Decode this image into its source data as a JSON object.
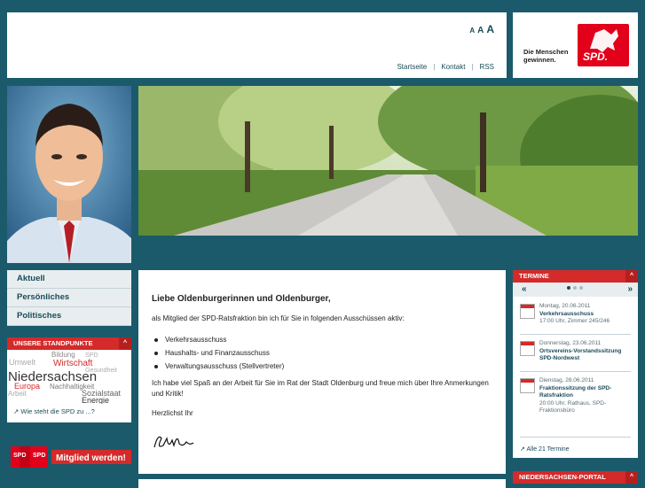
{
  "header": {
    "font_sizes": [
      "A",
      "A",
      "A"
    ],
    "nav": [
      "Startseite",
      "Kontakt",
      "RSS"
    ]
  },
  "logo": {
    "slogan_line1": "Die Menschen",
    "slogan_line2": "gewinnen.",
    "mark_text": "SPD."
  },
  "left_nav": {
    "items": [
      "Aktuell",
      "Persönliches",
      "Politisches"
    ]
  },
  "standpunkte": {
    "heading": "UNSERE STANDPUNKTE",
    "toggle": "^",
    "cloud_words": [
      "Bildung",
      "SPD",
      "Umwelt",
      "Wirtschaft",
      "Gesundheit",
      "Niedersachsen",
      "Europa",
      "Nachhaltigkeit",
      "Arbeit",
      "Sozialstaat",
      "Energie"
    ],
    "link": "Wie steht die SPD zu ...?"
  },
  "mitglied": {
    "label": "Mitglied werden!",
    "badge": "SPD"
  },
  "main": {
    "greeting": "Liebe Oldenburgerinnen und Oldenburger,",
    "intro": "als Mitglied der SPD-Ratsfraktion bin ich für Sie in folgenden Ausschüssen aktiv:",
    "committees": [
      "Verkehrsausschuss",
      "Haushalts- und Finanzausschuss",
      "Verwaltungsausschuss (Stellvertreter)"
    ],
    "paragraph": "Ich habe viel Spaß an der Arbeit für Sie im Rat der Stadt Oldenburg und freue mich über Ihre Anmerkungen und Kritik!",
    "closing": "Herzlichst Ihr"
  },
  "termine": {
    "heading": "TERMINE",
    "toggle": "^",
    "prev": "«",
    "next": "»",
    "events": [
      {
        "date": "Montag, 20.06.2011",
        "title": "Verkehrsausschuss",
        "meta": "17:00 Uhr,  Zimmer 245/246"
      },
      {
        "date": "Donnerstag, 23.06.2011",
        "title": "Ortsvereins-Vorstandssitzung SPD-Nordwest",
        "meta": ""
      },
      {
        "date": "Dienstag, 28.06.2011",
        "title": "Fraktionssitzung der SPD-Ratsfraktion",
        "meta": "20:00 Uhr,  Rathaus, SPD-Fraktionsbüro"
      }
    ],
    "all_link": "Alle 21 Termine"
  },
  "portal": {
    "heading": "NIEDERSACHSEN-PORTAL",
    "toggle": "^"
  },
  "colors": {
    "page_bg": "#1b5a6b",
    "accent_red": "#d42a2a",
    "text_blue": "#1a4b5a"
  }
}
